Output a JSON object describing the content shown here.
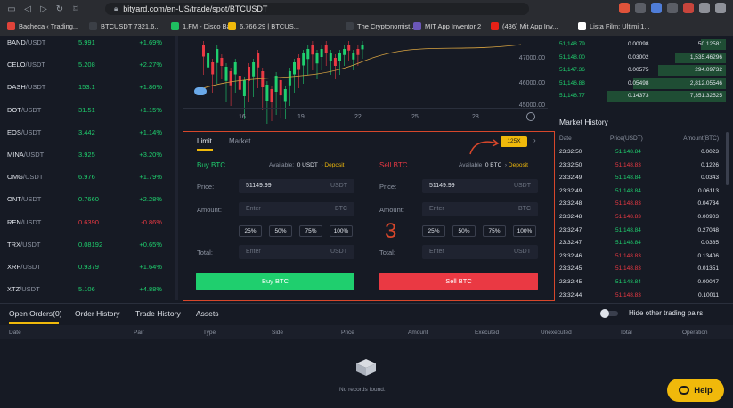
{
  "browser": {
    "url": "bityard.com/en-US/trade/spot/BTCUSDT",
    "bookmarks": [
      {
        "label": "Bacheca ‹ Trading...",
        "color": "#e0433a"
      },
      {
        "label": "BTCUSDT 7321.6...",
        "color": "#3b3f46"
      },
      {
        "label": "1.FM - Disco Ba...",
        "color": "#1fbf60"
      },
      {
        "label": "6,766.29 | BTCUS...",
        "color": "#f0b90b"
      },
      {
        "label": "The Cryptonomist...",
        "color": "#3b3f46"
      },
      {
        "label": "MIT App Inventor 2",
        "color": "#6b57b8"
      },
      {
        "label": "(436) Mit App Inv...",
        "color": "#e62117"
      },
      {
        "label": "Lista Film: Ultimi 1...",
        "color": "#ffffff"
      }
    ]
  },
  "markets": [
    {
      "base": "BAND",
      "quote": "/USDT",
      "price": "5.991",
      "change": "+1.69%",
      "dir": "up"
    },
    {
      "base": "CELO",
      "quote": "/USDT",
      "price": "5.208",
      "change": "+2.27%",
      "dir": "up"
    },
    {
      "base": "DASH",
      "quote": "/USDT",
      "price": "153.1",
      "change": "+1.86%",
      "dir": "up"
    },
    {
      "base": "DOT",
      "quote": "/USDT",
      "price": "31.51",
      "change": "+1.15%",
      "dir": "up"
    },
    {
      "base": "EOS",
      "quote": "/USDT",
      "price": "3.442",
      "change": "+1.14%",
      "dir": "up"
    },
    {
      "base": "MINA",
      "quote": "/USDT",
      "price": "3.925",
      "change": "+3.20%",
      "dir": "up"
    },
    {
      "base": "OMG",
      "quote": "/USDT",
      "price": "6.976",
      "change": "+1.79%",
      "dir": "up"
    },
    {
      "base": "ONT",
      "quote": "/USDT",
      "price": "0.7660",
      "change": "+2.28%",
      "dir": "up"
    },
    {
      "base": "REN",
      "quote": "/USDT",
      "price": "0.6390",
      "change": "-0.86%",
      "dir": "dn"
    },
    {
      "base": "TRX",
      "quote": "/USDT",
      "price": "0.08192",
      "change": "+0.65%",
      "dir": "up"
    },
    {
      "base": "XRP",
      "quote": "/USDT",
      "price": "0.9379",
      "change": "+1.64%",
      "dir": "up"
    },
    {
      "base": "XTZ",
      "quote": "/USDT",
      "price": "5.106",
      "change": "+4.88%",
      "dir": "up"
    }
  ],
  "chart": {
    "y_ticks": [
      "47000.00",
      "46000.00",
      "45000.00"
    ],
    "x_ticks": [
      "16",
      "19",
      "22",
      "25",
      "28"
    ]
  },
  "orderbook": [
    {
      "price": "51,148.79",
      "amount": "0.00098",
      "total": "50.12581"
    },
    {
      "price": "51,148.00",
      "amount": "0.03002",
      "total": "1,535.46296"
    },
    {
      "price": "51,147.36",
      "amount": "0.00575",
      "total": "294.09732"
    },
    {
      "price": "51,146.88",
      "amount": "0.05498",
      "total": "2,812.05546"
    },
    {
      "price": "51,146.77",
      "amount": "0.14373",
      "total": "7,351.32525"
    }
  ],
  "market_history": {
    "title": "Market History",
    "headers": [
      "Date",
      "Price(USDT)",
      "Amount(BTC)"
    ],
    "rows": [
      {
        "date": "23:32:50",
        "price": "51,148.84",
        "amount": "0.0023"
      },
      {
        "date": "23:32:50",
        "price": "51,148.83",
        "amount": "0.1226"
      },
      {
        "date": "23:32:49",
        "price": "51,148.84",
        "amount": "0.0343"
      },
      {
        "date": "23:32:49",
        "price": "51,148.84",
        "amount": "0.06113"
      },
      {
        "date": "23:32:48",
        "price": "51,148.83",
        "amount": "0.04734"
      },
      {
        "date": "23:32:48",
        "price": "51,148.83",
        "amount": "0.00903"
      },
      {
        "date": "23:32:47",
        "price": "51,148.84",
        "amount": "0.27048"
      },
      {
        "date": "23:32:47",
        "price": "51,148.84",
        "amount": "0.0385"
      },
      {
        "date": "23:32:46",
        "price": "51,148.83",
        "amount": "0.13406"
      },
      {
        "date": "23:32:45",
        "price": "51,148.83",
        "amount": "0.01351"
      },
      {
        "date": "23:32:45",
        "price": "51,148.84",
        "amount": "0.00047"
      },
      {
        "date": "23:32:44",
        "price": "51,148.83",
        "amount": "0.10011"
      }
    ]
  },
  "order": {
    "tab_limit": "Limit",
    "tab_market": "Market",
    "leverage": "125X",
    "annotation": "3",
    "buy": {
      "title": "Buy BTC",
      "available_label": "Available:",
      "available_value": "0 USDT",
      "deposit": "Deposit",
      "price_label": "Price:",
      "price_value": "51149.99",
      "price_unit": "USDT",
      "amount_label": "Amount:",
      "amount_placeholder": "Enter",
      "amount_unit": "BTC",
      "total_label": "Total:",
      "total_placeholder": "Enter",
      "total_unit": "USDT",
      "button": "Buy BTC"
    },
    "sell": {
      "title": "Sell BTC",
      "available_label": "Available",
      "available_value": "0 BTC",
      "deposit": "Deposit",
      "price_label": "Price:",
      "price_value": "51149.99",
      "price_unit": "USDT",
      "amount_label": "Amount:",
      "amount_placeholder": "Enter",
      "amount_unit": "BTC",
      "total_label": "Total:",
      "total_placeholder": "Enter",
      "total_unit": "USDT",
      "button": "Sell BTC"
    },
    "percents": [
      "25%",
      "50%",
      "75%",
      "100%"
    ]
  },
  "bottom": {
    "tabs": [
      "Open Orders(0)",
      "Order History",
      "Trade History",
      "Assets"
    ],
    "hide_label": "Hide other trading pairs",
    "columns": [
      "Date",
      "Pair",
      "Type",
      "Side",
      "Price",
      "Amount",
      "Executed",
      "Unexecuted",
      "Total",
      "Operation"
    ],
    "empty": "No records found.",
    "help": "Help"
  },
  "colors": {
    "up": "#1fcf6e",
    "down": "#ea3943",
    "accent": "#f0b90b",
    "highlight": "#d7472b"
  }
}
